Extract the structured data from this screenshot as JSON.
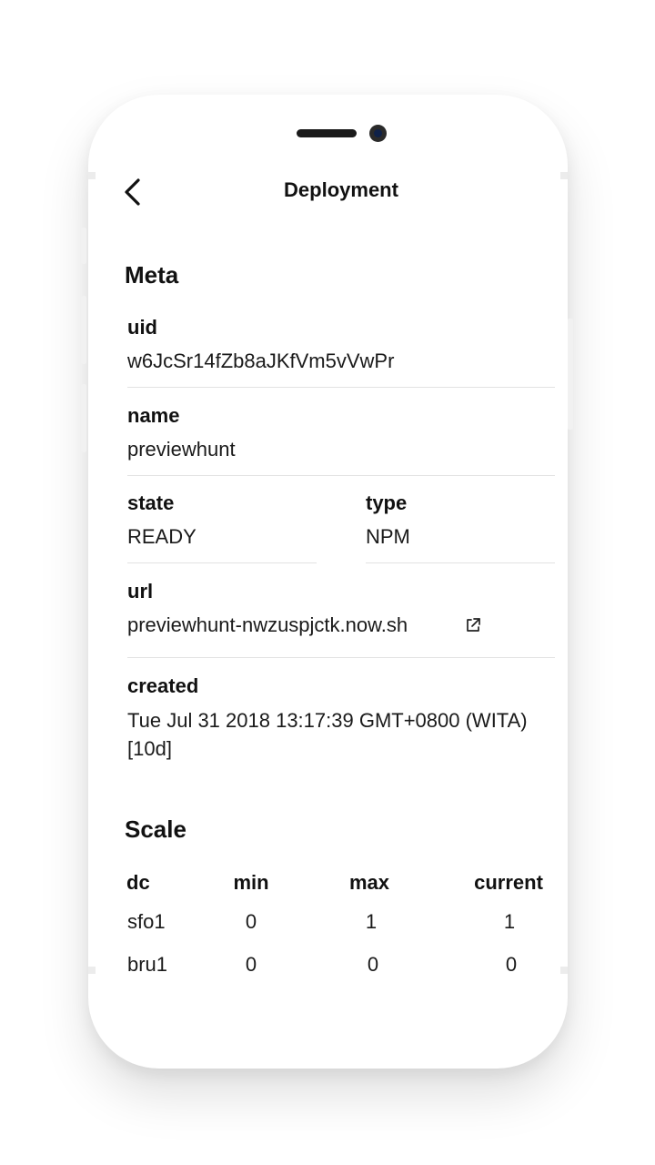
{
  "nav": {
    "title": "Deployment"
  },
  "meta": {
    "section_title": "Meta",
    "uid": {
      "label": "uid",
      "value": "w6JcSr14fZb8aJKfVm5vVwPr"
    },
    "name": {
      "label": "name",
      "value": "previewhunt"
    },
    "state": {
      "label": "state",
      "value": "READY"
    },
    "type": {
      "label": "type",
      "value": "NPM"
    },
    "url": {
      "label": "url",
      "value": "previewhunt-nwzuspjctk.now.sh"
    },
    "created": {
      "label": "created",
      "value": "Tue Jul 31 2018 13:17:39 GMT+0800 (WITA) [10d]"
    }
  },
  "scale": {
    "section_title": "Scale",
    "headers": [
      "dc",
      "min",
      "max",
      "current"
    ],
    "rows": [
      [
        "sfo1",
        "0",
        "1",
        "1"
      ],
      [
        "bru1",
        "0",
        "0",
        "0"
      ]
    ]
  },
  "icons": {
    "back": "chevron-left-icon",
    "external_link": "external-link-icon"
  }
}
